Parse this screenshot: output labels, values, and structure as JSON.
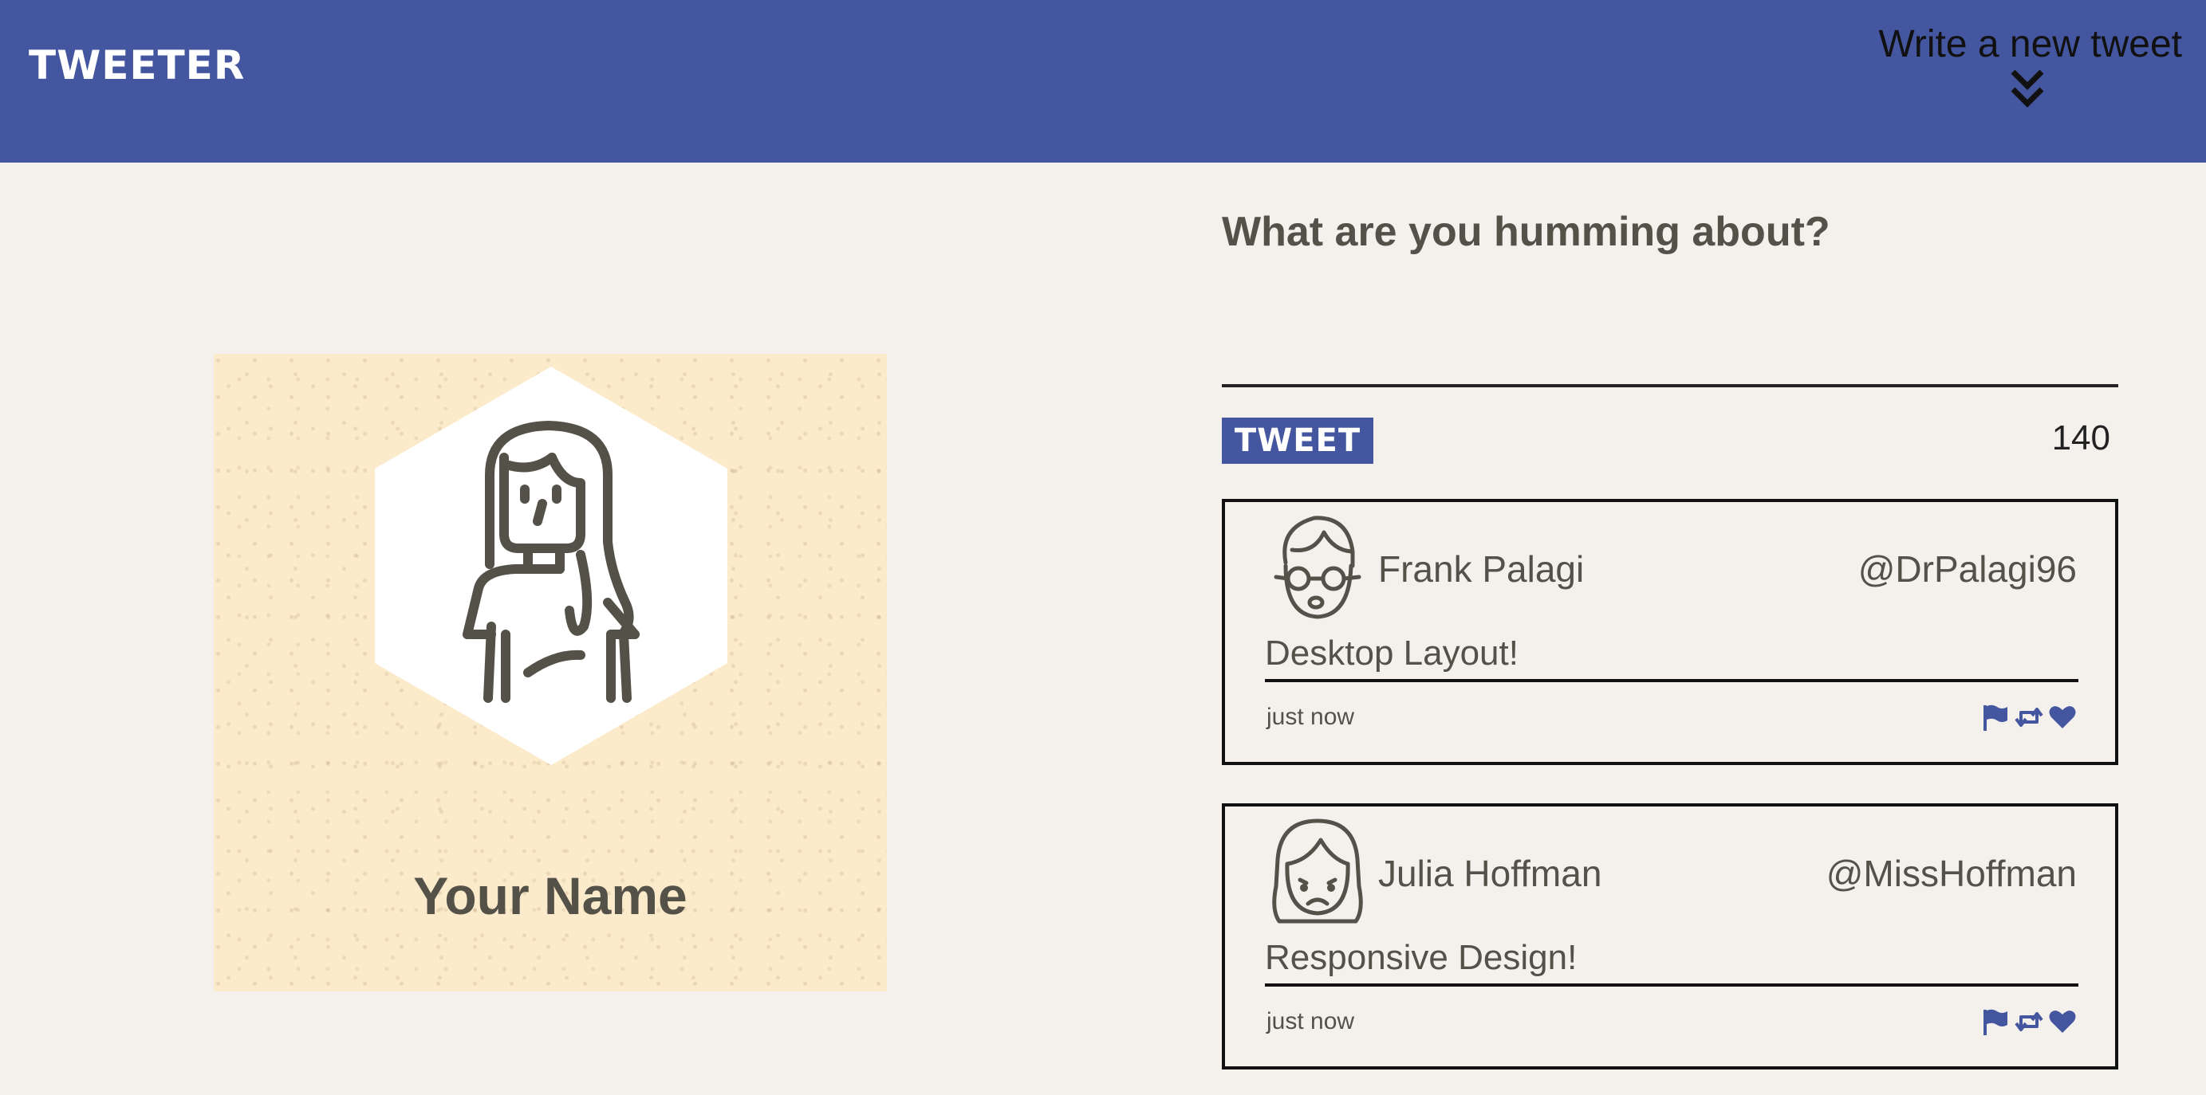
{
  "nav": {
    "logo": "TWEETER",
    "compose_label": "Write a new tweet",
    "compose_icon": "double-chevron-down-icon"
  },
  "profile": {
    "name": "Your Name",
    "avatar_icon": "woman-avatar-icon"
  },
  "composer": {
    "title": "What are you humming about?",
    "input_value": "",
    "button_label": "TWEET",
    "char_count": "140"
  },
  "tweets": [
    {
      "author": "Frank Palagi",
      "handle": "@DrPalagi96",
      "text": "Desktop Layout!",
      "time": "just now",
      "avatar_icon": "man-with-glasses-avatar-icon"
    },
    {
      "author": "Julia Hoffman",
      "handle": "@MissHoffman",
      "text": "Responsive Design!",
      "time": "just now",
      "avatar_icon": "woman-avatar-icon"
    }
  ],
  "actions": [
    "flag-icon",
    "retweet-icon",
    "heart-icon"
  ],
  "colors": {
    "accent": "#4456a0",
    "background": "#f4f1ec",
    "text": "#545149",
    "profile_card": "#fcebcb"
  }
}
